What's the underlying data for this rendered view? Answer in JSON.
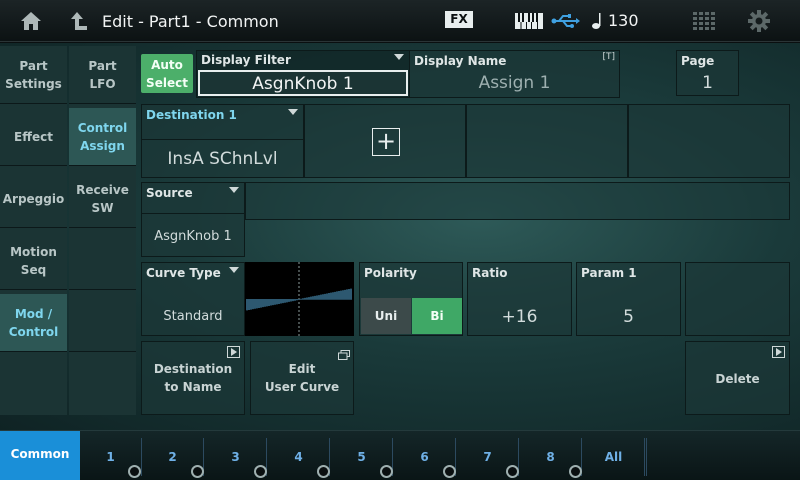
{
  "header": {
    "title": "Edit - Part1 - Common",
    "fx_badge": "FX",
    "tempo": "130",
    "icons": [
      "home-icon",
      "up-arrow-icon",
      "keyboard-icon",
      "usb-icon",
      "note-icon",
      "grid-icon",
      "gear-icon"
    ]
  },
  "left_nav": [
    {
      "label": "Part\nSettings"
    },
    {
      "label": "Effect"
    },
    {
      "label": "Arpeggio"
    },
    {
      "label": "Motion\nSeq"
    },
    {
      "label": "Mod /\nControl",
      "selected": true
    },
    {
      "label": ""
    }
  ],
  "sub_nav": [
    {
      "label": "Part\nLFO"
    },
    {
      "label": "Control\nAssign",
      "selected": true
    },
    {
      "label": "Receive\nSW"
    },
    {
      "label": ""
    },
    {
      "label": ""
    },
    {
      "label": ""
    }
  ],
  "auto_select": {
    "label": "Auto\nSelect"
  },
  "display_filter": {
    "label": "Display Filter",
    "value": "AsgnKnob 1"
  },
  "display_name": {
    "label": "Display Name",
    "value": "Assign 1",
    "badge": "[T]"
  },
  "page": {
    "label": "Page",
    "value": "1"
  },
  "destination": {
    "label": "Destination 1",
    "value": "InsA SChnLvl",
    "add_symbol": "+"
  },
  "source": {
    "label": "Source",
    "value": "AsgnKnob 1"
  },
  "curve_type": {
    "label": "Curve Type",
    "value": "Standard"
  },
  "polarity": {
    "label": "Polarity",
    "options": [
      "Uni",
      "Bi"
    ],
    "selected": "Bi"
  },
  "ratio": {
    "label": "Ratio",
    "value": "+16"
  },
  "param1": {
    "label": "Param 1",
    "value": "5"
  },
  "actions": {
    "dest_to_name": "Destination\nto Name",
    "edit_user_curve": "Edit\nUser Curve",
    "delete": "Delete"
  },
  "bottom_tabs": [
    "Common",
    "1",
    "2",
    "3",
    "4",
    "5",
    "6",
    "7",
    "8",
    "All"
  ],
  "colors": {
    "accent_green": "#4caf6a",
    "accent_blue": "#7fd6ee",
    "tab_blue": "#1a8fd8"
  }
}
